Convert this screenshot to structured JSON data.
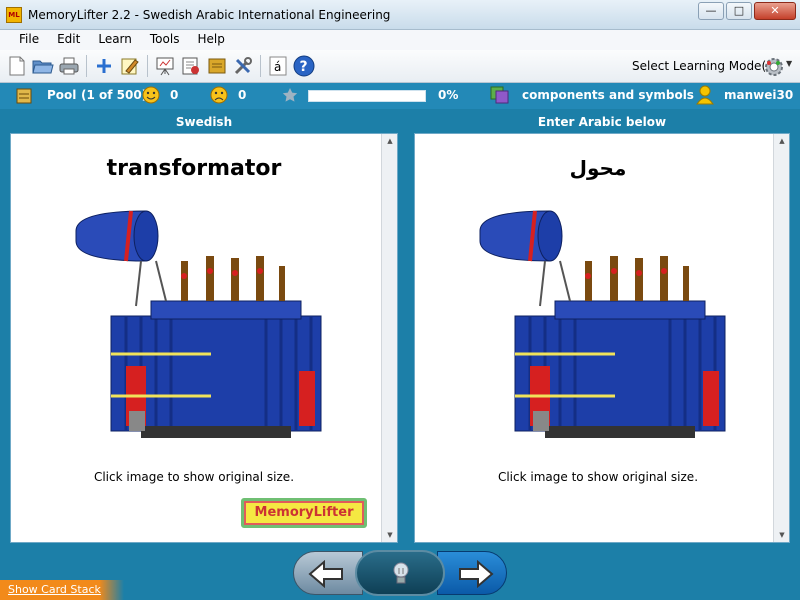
{
  "window": {
    "title": "MemoryLifter 2.2 - Swedish Arabic International Engineering",
    "app_icon_text": "ML"
  },
  "menu": [
    "File",
    "Edit",
    "Learn",
    "Tools",
    "Help"
  ],
  "toolbar": {
    "mode_label": "Select Learning Mode(s)",
    "char_button": "á",
    "help_button": "?"
  },
  "status": {
    "pool_label": "Pool",
    "pool_count": "(1 of 500)",
    "known_count": "0",
    "unknown_count": "0",
    "progress_text": "0%",
    "progress_value": 0,
    "chapter": "components and symbols",
    "user": "manwei30"
  },
  "left_panel": {
    "header": "Swedish",
    "word": "transformator",
    "hint": "Click image to show original size.",
    "logo_part1": "Memory",
    "logo_part2": "Lifter"
  },
  "right_panel": {
    "header": "Enter Arabic below",
    "word": "محول",
    "hint": "Click image to show original size."
  },
  "footer": {
    "show_card_stack": "Show Card Stack"
  }
}
